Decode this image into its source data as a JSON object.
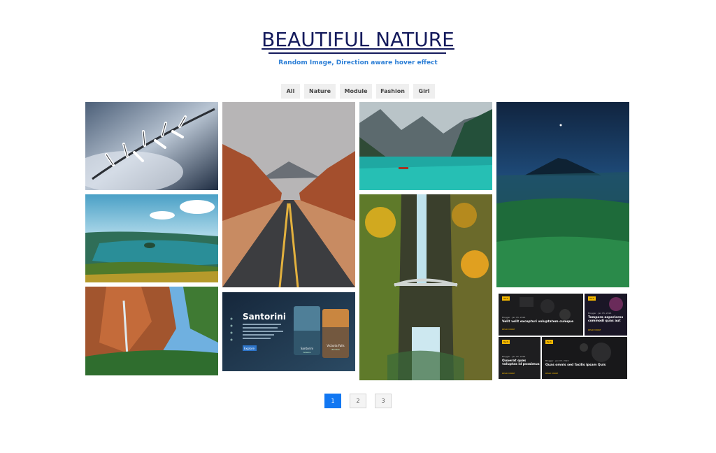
{
  "header": {
    "title": "BEAUTIFUL NATURE",
    "subtitle": "Random Image, Direction aware hover effect"
  },
  "filters": [
    "All",
    "Nature",
    "Module",
    "Fashion",
    "Girl"
  ],
  "santorini_card": {
    "heading": "Santorini",
    "button": "Explore",
    "card_a_title": "Santorini",
    "card_a_sub": "Greece",
    "card_b_title": "Victoria Falls",
    "card_b_sub": "Zambia"
  },
  "blog_cards": [
    {
      "tag": "Tech",
      "meta": "Blogger · Jan 05, 2024",
      "title": "Velit velit excepturi voluptatem cumque",
      "link": "READ MORE"
    },
    {
      "tag": "Tech",
      "meta": "Blogger · Jan 05, 2024",
      "title": "Tempora asperiores commodi quas aut",
      "link": "READ MORE"
    },
    {
      "tag": "Tech",
      "meta": "Blogger · Jan 05, 2024",
      "title": "Quaerat quas voluptas id possimus",
      "link": "READ MORE"
    },
    {
      "tag": "Tech",
      "meta": "Blogger · Jan 05, 2024",
      "title": "Quas omnis sed facilis ipsam Quis",
      "link": "READ MORE"
    }
  ],
  "pagination": [
    "1",
    "2",
    "3"
  ],
  "colors": {
    "title": "#141a5c",
    "subtitle": "#2d7fd6",
    "active_page": "#1177f2"
  }
}
